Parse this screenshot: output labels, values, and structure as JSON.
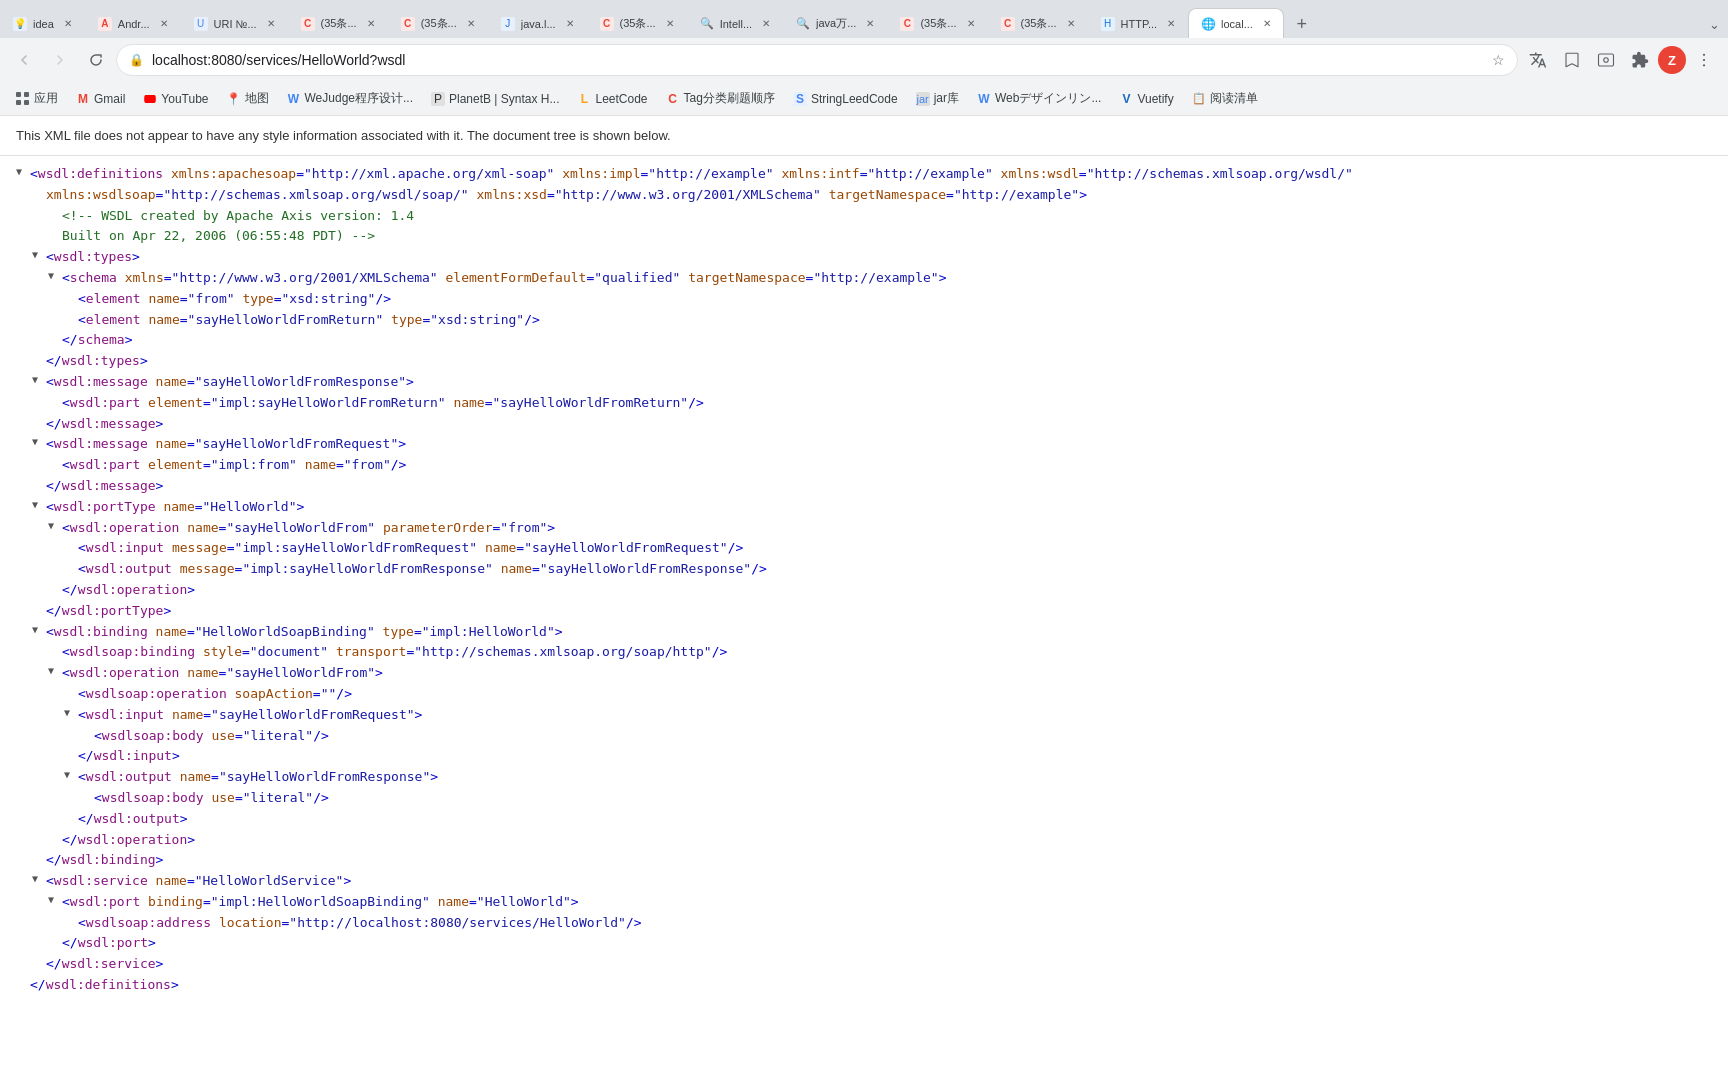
{
  "browser": {
    "tabs": [
      {
        "id": 1,
        "favicon_color": "#4285f4",
        "favicon_text": "💡",
        "title": "idea",
        "active": false
      },
      {
        "id": 2,
        "favicon_color": "#ea4335",
        "favicon_text": "A",
        "title": "Andr...",
        "active": false
      },
      {
        "id": 3,
        "favicon_color": "#4285f4",
        "favicon_text": "U",
        "title": "URI №...",
        "active": false
      },
      {
        "id": 4,
        "favicon_color": "#ea4335",
        "favicon_text": "C",
        "title": "(35条...",
        "active": false
      },
      {
        "id": 5,
        "favicon_color": "#ea4335",
        "favicon_text": "C",
        "title": "(35条...",
        "active": false
      },
      {
        "id": 6,
        "favicon_color": "#4285f4",
        "favicon_text": "J",
        "title": "java.l...",
        "active": false
      },
      {
        "id": 7,
        "favicon_color": "#ea4335",
        "favicon_text": "C",
        "title": "(35条...",
        "active": false
      },
      {
        "id": 8,
        "favicon_color": "#5f6368",
        "favicon_text": "🔍",
        "title": "Intell...",
        "active": false
      },
      {
        "id": 9,
        "favicon_color": "#5f6368",
        "favicon_text": "🔍",
        "title": "java万...",
        "active": false
      },
      {
        "id": 10,
        "favicon_color": "#ea4335",
        "favicon_text": "C",
        "title": "(35条...",
        "active": false
      },
      {
        "id": 11,
        "favicon_color": "#ea4335",
        "favicon_text": "C",
        "title": "(35条...",
        "active": false
      },
      {
        "id": 12,
        "favicon_color": "#1a73e8",
        "favicon_text": "H",
        "title": "HTTP...",
        "active": false
      },
      {
        "id": 13,
        "favicon_color": "#1a73e8",
        "favicon_text": "🌐",
        "title": "local...",
        "active": true
      }
    ],
    "url": "localhost:8080/services/HelloWorld?wsdl",
    "profile_letter": "Z",
    "profile_color": "#ea4335"
  },
  "bookmarks": [
    {
      "text": "应用",
      "favicon": "⬛"
    },
    {
      "text": "Gmail",
      "favicon": "M",
      "favicon_color": "#ea4335"
    },
    {
      "text": "YouTube",
      "favicon": "▶",
      "favicon_color": "#ff0000"
    },
    {
      "text": "地图",
      "favicon": "📍",
      "favicon_color": "#4285f4"
    },
    {
      "text": "WeJudge程序设计...",
      "favicon": "W",
      "favicon_color": "#4285f4"
    },
    {
      "text": "PlanetB | Syntax H...",
      "favicon": "P",
      "favicon_color": "#333"
    },
    {
      "text": "LeetCode",
      "favicon": "L",
      "favicon_color": "#ffa116"
    },
    {
      "text": "Tag分类刷题顺序",
      "favicon": "T",
      "favicon_color": "#ea4335"
    },
    {
      "text": "StringLeedCode",
      "favicon": "S",
      "favicon_color": "#4285f4"
    },
    {
      "text": "jar库",
      "favicon": "☕",
      "favicon_color": "#4285f4"
    },
    {
      "text": "Webデザインリン...",
      "favicon": "W",
      "favicon_color": "#4285f4"
    },
    {
      "text": "Vuetify",
      "favicon": "V",
      "favicon_color": "#1867c0"
    },
    {
      "text": "阅读清单",
      "favicon": "📋",
      "favicon_color": "#5f6368"
    }
  ],
  "notice": "This XML file does not appear to have any style information associated with it. The document tree is shown below.",
  "xml": {
    "lines": [
      {
        "indent": 0,
        "toggle": "▼",
        "content": "<span class='tag-bracket'>&lt;</span><span class='tag-name'>wsdl:definitions</span> <span class='attr-name'>xmlns:apachesoap</span><span class='punct'>=</span><span class='attr-value'>\"http://xml.apache.org/xml-soap\"</span> <span class='attr-name'>xmlns:impl</span><span class='punct'>=</span><span class='attr-value'>\"http://example\"</span> <span class='attr-name'>xmlns:intf</span><span class='punct'>=</span><span class='attr-value'>\"http://example\"</span> <span class='attr-name'>xmlns:wsdl</span><span class='punct'>=</span><span class='attr-value'>\"http://schemas.xmlsoap.org/wsdl/\"</span>"
      },
      {
        "indent": 1,
        "toggle": "",
        "content": "<span class='attr-name'>xmlns:wsdlsoap</span><span class='punct'>=</span><span class='attr-value'>\"http://schemas.xmlsoap.org/wsdl/soap/\"</span> <span class='attr-name'>xmlns:xsd</span><span class='punct'>=</span><span class='attr-value'>\"http://www.w3.org/2001/XMLSchema\"</span> <span class='attr-name'>targetNamespace</span><span class='punct'>=</span><span class='attr-value'>\"http://example\"</span><span class='tag-bracket'>&gt;</span>"
      },
      {
        "indent": 2,
        "toggle": "",
        "content": "<span class='comment'>&lt;!-- WSDL created by Apache Axis version: 1.4</span>"
      },
      {
        "indent": 2,
        "toggle": "",
        "content": "<span class='comment'>Built on Apr 22, 2006 (06:55:48 PDT) --&gt;</span>"
      },
      {
        "indent": 1,
        "toggle": "▼",
        "content": "<span class='tag-bracket'>&lt;</span><span class='tag-name'>wsdl:types</span><span class='tag-bracket'>&gt;</span>"
      },
      {
        "indent": 2,
        "toggle": "▼",
        "content": "<span class='tag-bracket'>&lt;</span><span class='tag-name'>schema</span> <span class='attr-name'>xmlns</span><span class='punct'>=</span><span class='attr-value'>\"http://www.w3.org/2001/XMLSchema\"</span> <span class='attr-name'>elementFormDefault</span><span class='punct'>=</span><span class='attr-value'>\"qualified\"</span> <span class='attr-name'>targetNamespace</span><span class='punct'>=</span><span class='attr-value'>\"http://example\"</span><span class='tag-bracket'>&gt;</span>"
      },
      {
        "indent": 3,
        "toggle": "",
        "content": "<span class='tag-bracket'>&lt;</span><span class='tag-name'>element</span> <span class='attr-name'>name</span><span class='punct'>=</span><span class='attr-value'>\"from\"</span> <span class='attr-name'>type</span><span class='punct'>=</span><span class='attr-value'>\"xsd:string\"</span><span class='punct'>/&gt;</span>"
      },
      {
        "indent": 3,
        "toggle": "",
        "content": "<span class='tag-bracket'>&lt;</span><span class='tag-name'>element</span> <span class='attr-name'>name</span><span class='punct'>=</span><span class='attr-value'>\"sayHelloWorldFromReturn\"</span> <span class='attr-name'>type</span><span class='punct'>=</span><span class='attr-value'>\"xsd:string\"</span><span class='punct'>/&gt;</span>"
      },
      {
        "indent": 2,
        "toggle": "",
        "content": "<span class='tag-bracket'>&lt;/</span><span class='tag-name'>schema</span><span class='tag-bracket'>&gt;</span>"
      },
      {
        "indent": 1,
        "toggle": "",
        "content": "<span class='tag-bracket'>&lt;/</span><span class='tag-name'>wsdl:types</span><span class='tag-bracket'>&gt;</span>"
      },
      {
        "indent": 1,
        "toggle": "▼",
        "content": "<span class='tag-bracket'>&lt;</span><span class='tag-name'>wsdl:message</span> <span class='attr-name'>name</span><span class='punct'>=</span><span class='attr-value'>\"sayHelloWorldFromResponse\"</span><span class='tag-bracket'>&gt;</span>"
      },
      {
        "indent": 2,
        "toggle": "",
        "content": "<span class='tag-bracket'>&lt;</span><span class='tag-name'>wsdl:part</span> <span class='attr-name'>element</span><span class='punct'>=</span><span class='attr-value'>\"impl:sayHelloWorldFromReturn\"</span> <span class='attr-name'>name</span><span class='punct'>=</span><span class='attr-value'>\"sayHelloWorldFromReturn\"</span><span class='punct'>/&gt;</span>"
      },
      {
        "indent": 1,
        "toggle": "",
        "content": "<span class='tag-bracket'>&lt;/</span><span class='tag-name'>wsdl:message</span><span class='tag-bracket'>&gt;</span>"
      },
      {
        "indent": 1,
        "toggle": "▼",
        "content": "<span class='tag-bracket'>&lt;</span><span class='tag-name'>wsdl:message</span> <span class='attr-name'>name</span><span class='punct'>=</span><span class='attr-value'>\"sayHelloWorldFromRequest\"</span><span class='tag-bracket'>&gt;</span>"
      },
      {
        "indent": 2,
        "toggle": "",
        "content": "<span class='tag-bracket'>&lt;</span><span class='tag-name'>wsdl:part</span> <span class='attr-name'>element</span><span class='punct'>=</span><span class='attr-value'>\"impl:from\"</span> <span class='attr-name'>name</span><span class='punct'>=</span><span class='attr-value'>\"from\"</span><span class='punct'>/&gt;</span>"
      },
      {
        "indent": 1,
        "toggle": "",
        "content": "<span class='tag-bracket'>&lt;/</span><span class='tag-name'>wsdl:message</span><span class='tag-bracket'>&gt;</span>"
      },
      {
        "indent": 1,
        "toggle": "▼",
        "content": "<span class='tag-bracket'>&lt;</span><span class='tag-name'>wsdl:portType</span> <span class='attr-name'>name</span><span class='punct'>=</span><span class='attr-value'>\"HelloWorld\"</span><span class='tag-bracket'>&gt;</span>"
      },
      {
        "indent": 2,
        "toggle": "▼",
        "content": "<span class='tag-bracket'>&lt;</span><span class='tag-name'>wsdl:operation</span> <span class='attr-name'>name</span><span class='punct'>=</span><span class='attr-value'>\"sayHelloWorldFrom\"</span> <span class='attr-name'>parameterOrder</span><span class='punct'>=</span><span class='attr-value'>\"from\"</span><span class='tag-bracket'>&gt;</span>"
      },
      {
        "indent": 3,
        "toggle": "",
        "content": "<span class='tag-bracket'>&lt;</span><span class='tag-name'>wsdl:input</span> <span class='attr-name'>message</span><span class='punct'>=</span><span class='attr-value'>\"impl:sayHelloWorldFromRequest\"</span> <span class='attr-name'>name</span><span class='punct'>=</span><span class='attr-value'>\"sayHelloWorldFromRequest\"</span><span class='punct'>/&gt;</span>"
      },
      {
        "indent": 3,
        "toggle": "",
        "content": "<span class='tag-bracket'>&lt;</span><span class='tag-name'>wsdl:output</span> <span class='attr-name'>message</span><span class='punct'>=</span><span class='attr-value'>\"impl:sayHelloWorldFromResponse\"</span> <span class='attr-name'>name</span><span class='punct'>=</span><span class='attr-value'>\"sayHelloWorldFromResponse\"</span><span class='punct'>/&gt;</span>"
      },
      {
        "indent": 2,
        "toggle": "",
        "content": "<span class='tag-bracket'>&lt;/</span><span class='tag-name'>wsdl:operation</span><span class='tag-bracket'>&gt;</span>"
      },
      {
        "indent": 1,
        "toggle": "",
        "content": "<span class='tag-bracket'>&lt;/</span><span class='tag-name'>wsdl:portType</span><span class='tag-bracket'>&gt;</span>"
      },
      {
        "indent": 1,
        "toggle": "▼",
        "content": "<span class='tag-bracket'>&lt;</span><span class='tag-name'>wsdl:binding</span> <span class='attr-name'>name</span><span class='punct'>=</span><span class='attr-value'>\"HelloWorldSoapBinding\"</span> <span class='attr-name'>type</span><span class='punct'>=</span><span class='attr-value'>\"impl:HelloWorld\"</span><span class='tag-bracket'>&gt;</span>"
      },
      {
        "indent": 2,
        "toggle": "",
        "content": "<span class='tag-bracket'>&lt;</span><span class='tag-name'>wsdlsoap:binding</span> <span class='attr-name'>style</span><span class='punct'>=</span><span class='attr-value'>\"document\"</span> <span class='attr-name'>transport</span><span class='punct'>=</span><span class='attr-value'>\"http://schemas.xmlsoap.org/soap/http\"</span><span class='punct'>/&gt;</span>"
      },
      {
        "indent": 2,
        "toggle": "▼",
        "content": "<span class='tag-bracket'>&lt;</span><span class='tag-name'>wsdl:operation</span> <span class='attr-name'>name</span><span class='punct'>=</span><span class='attr-value'>\"sayHelloWorldFrom\"</span><span class='tag-bracket'>&gt;</span>"
      },
      {
        "indent": 3,
        "toggle": "",
        "content": "<span class='tag-bracket'>&lt;</span><span class='tag-name'>wsdlsoap:operation</span> <span class='attr-name'>soapAction</span><span class='punct'>=</span><span class='attr-value'>\"\"</span><span class='punct'>/&gt;</span>"
      },
      {
        "indent": 3,
        "toggle": "▼",
        "content": "<span class='tag-bracket'>&lt;</span><span class='tag-name'>wsdl:input</span> <span class='attr-name'>name</span><span class='punct'>=</span><span class='attr-value'>\"sayHelloWorldFromRequest\"</span><span class='tag-bracket'>&gt;</span>"
      },
      {
        "indent": 4,
        "toggle": "",
        "content": "<span class='tag-bracket'>&lt;</span><span class='tag-name'>wsdlsoap:body</span> <span class='attr-name'>use</span><span class='punct'>=</span><span class='attr-value'>\"literal\"</span><span class='punct'>/&gt;</span>"
      },
      {
        "indent": 3,
        "toggle": "",
        "content": "<span class='tag-bracket'>&lt;/</span><span class='tag-name'>wsdl:input</span><span class='tag-bracket'>&gt;</span>"
      },
      {
        "indent": 3,
        "toggle": "▼",
        "content": "<span class='tag-bracket'>&lt;</span><span class='tag-name'>wsdl:output</span> <span class='attr-name'>name</span><span class='punct'>=</span><span class='attr-value'>\"sayHelloWorldFromResponse\"</span><span class='tag-bracket'>&gt;</span>"
      },
      {
        "indent": 4,
        "toggle": "",
        "content": "<span class='tag-bracket'>&lt;</span><span class='tag-name'>wsdlsoap:body</span> <span class='attr-name'>use</span><span class='punct'>=</span><span class='attr-value'>\"literal\"</span><span class='punct'>/&gt;</span>"
      },
      {
        "indent": 3,
        "toggle": "",
        "content": "<span class='tag-bracket'>&lt;/</span><span class='tag-name'>wsdl:output</span><span class='tag-bracket'>&gt;</span>"
      },
      {
        "indent": 2,
        "toggle": "",
        "content": "<span class='tag-bracket'>&lt;/</span><span class='tag-name'>wsdl:operation</span><span class='tag-bracket'>&gt;</span>"
      },
      {
        "indent": 1,
        "toggle": "",
        "content": "<span class='tag-bracket'>&lt;/</span><span class='tag-name'>wsdl:binding</span><span class='tag-bracket'>&gt;</span>"
      },
      {
        "indent": 1,
        "toggle": "▼",
        "content": "<span class='tag-bracket'>&lt;</span><span class='tag-name'>wsdl:service</span> <span class='attr-name'>name</span><span class='punct'>=</span><span class='attr-value'>\"HelloWorldService\"</span><span class='tag-bracket'>&gt;</span>"
      },
      {
        "indent": 2,
        "toggle": "▼",
        "content": "<span class='tag-bracket'>&lt;</span><span class='tag-name'>wsdl:port</span> <span class='attr-name'>binding</span><span class='punct'>=</span><span class='attr-value'>\"impl:HelloWorldSoapBinding\"</span> <span class='attr-name'>name</span><span class='punct'>=</span><span class='attr-value'>\"HelloWorld\"</span><span class='tag-bracket'>&gt;</span>"
      },
      {
        "indent": 3,
        "toggle": "",
        "content": "<span class='tag-bracket'>&lt;</span><span class='tag-name'>wsdlsoap:address</span> <span class='attr-name'>location</span><span class='punct'>=</span><span class='attr-value'>\"http://localhost:8080/services/HelloWorld\"</span><span class='punct'>/&gt;</span>"
      },
      {
        "indent": 2,
        "toggle": "",
        "content": "<span class='tag-bracket'>&lt;/</span><span class='tag-name'>wsdl:port</span><span class='tag-bracket'>&gt;</span>"
      },
      {
        "indent": 1,
        "toggle": "",
        "content": "<span class='tag-bracket'>&lt;/</span><span class='tag-name'>wsdl:service</span><span class='tag-bracket'>&gt;</span>"
      },
      {
        "indent": 0,
        "toggle": "",
        "content": "<span class='tag-bracket'>&lt;/</span><span class='tag-name'>wsdl:definitions</span><span class='tag-bracket'>&gt;</span>"
      }
    ]
  }
}
